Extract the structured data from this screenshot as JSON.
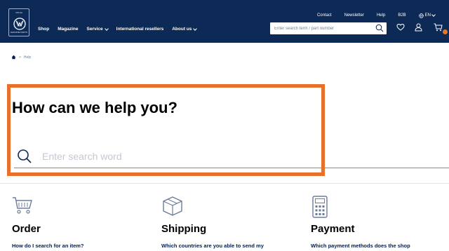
{
  "header": {
    "logo": {
      "top_text": "VW AG",
      "bottom_text": "GENUINE PARTS",
      "icon": "vw-logo"
    },
    "top_nav": [
      "Contact",
      "Newsletter",
      "Help",
      "B2B"
    ],
    "language": "EN",
    "main_nav": [
      {
        "label": "Shop",
        "dropdown": false
      },
      {
        "label": "Magazine",
        "dropdown": false
      },
      {
        "label": "Service",
        "dropdown": true
      },
      {
        "label": "International resellers",
        "dropdown": false
      },
      {
        "label": "About us",
        "dropdown": true
      }
    ],
    "search_placeholder": "Enter search term / part number",
    "icons": [
      "search-icon",
      "heart-icon",
      "user-icon",
      "cart-icon",
      "globe-icon"
    ],
    "colors": {
      "background": "#0d2a57",
      "accent": "#e87722"
    }
  },
  "breadcrumb": {
    "home_icon": "home-icon",
    "current": "Help"
  },
  "help": {
    "title": "How can we help you?",
    "search_placeholder": "Enter search word",
    "highlight_color": "#e8702a"
  },
  "categories": [
    {
      "icon": "cart-icon",
      "title": "Order",
      "first_question": "How do I search for an item?"
    },
    {
      "icon": "package-icon",
      "title": "Shipping",
      "first_question": "Which countries are you able to send my"
    },
    {
      "icon": "calculator-icon",
      "title": "Payment",
      "first_question": "Which payment methods does the shop"
    }
  ]
}
